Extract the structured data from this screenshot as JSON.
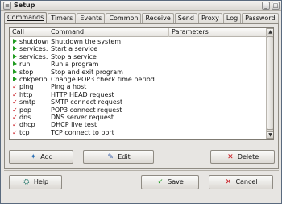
{
  "window": {
    "title": "Setup"
  },
  "tabs": [
    {
      "label": "Commands",
      "active": true
    },
    {
      "label": "Timers"
    },
    {
      "label": "Events"
    },
    {
      "label": "Common"
    },
    {
      "label": "Receive"
    },
    {
      "label": "Send"
    },
    {
      "label": "Proxy"
    },
    {
      "label": "Log"
    },
    {
      "label": "Password"
    }
  ],
  "table": {
    "columns": [
      "Call",
      "Command",
      "Parameters"
    ],
    "rows": [
      {
        "icon": "play",
        "call": "shutdown",
        "command": "Shutdown the system",
        "params": ""
      },
      {
        "icon": "play",
        "call": "services...",
        "command": "Start a service",
        "params": ""
      },
      {
        "icon": "play",
        "call": "services...",
        "command": "Stop a service",
        "params": ""
      },
      {
        "icon": "play",
        "call": "run",
        "command": "Run a program",
        "params": ""
      },
      {
        "icon": "play",
        "call": "stop",
        "command": "Stop and exit program",
        "params": ""
      },
      {
        "icon": "play",
        "call": "chkperiod",
        "command": "Change POP3 check time period",
        "params": ""
      },
      {
        "icon": "check",
        "call": "ping",
        "command": "Ping a host",
        "params": ""
      },
      {
        "icon": "check",
        "call": "http",
        "command": "HTTP HEAD request",
        "params": ""
      },
      {
        "icon": "check",
        "call": "smtp",
        "command": "SMTP connect request",
        "params": ""
      },
      {
        "icon": "check",
        "call": "pop",
        "command": "POP3 connect request",
        "params": ""
      },
      {
        "icon": "check",
        "call": "dns",
        "command": "DNS server request",
        "params": ""
      },
      {
        "icon": "check",
        "call": "dhcp",
        "command": "DHCP live test",
        "params": ""
      },
      {
        "icon": "check",
        "call": "tcp",
        "command": "TCP connect to port",
        "params": ""
      }
    ]
  },
  "buttons": {
    "add": "Add",
    "edit": "Edit",
    "delete": "Delete",
    "help": "Help",
    "save": "Save",
    "cancel": "Cancel"
  },
  "icons": {
    "title": "window-menu-icon",
    "add": "add-icon",
    "edit": "pencil-icon",
    "delete": "red-x-icon",
    "help": "help-icon",
    "save": "green-check-icon",
    "cancel": "red-x-icon"
  },
  "colors": {
    "play_icon": "#1f9a1f",
    "check_icon": "#c8141b",
    "delete_icon": "#c8141b",
    "save_icon": "#1f9a1f"
  }
}
